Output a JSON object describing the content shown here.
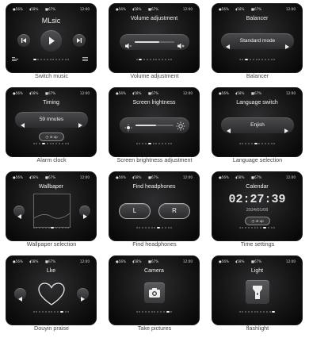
{
  "status": {
    "bt": "●56%",
    "signal": "◖58%",
    "headphones": "■67%",
    "time": "12:00"
  },
  "cells": [
    {
      "caption": "Switch music",
      "title": "MLsic"
    },
    {
      "caption": "Volume adjustment",
      "title": "Volume adjustment",
      "volume_level": 0.62
    },
    {
      "caption": "Balancer",
      "title": "Balancer",
      "value": "Standard mode"
    },
    {
      "caption": "Alarm clock",
      "title": "Timing",
      "value": "59 mnutes",
      "button": "ot up"
    },
    {
      "caption": "Screen brightness adjustment",
      "title": "Screen lrightness",
      "brightness_level": 0.55
    },
    {
      "caption": "Language selection",
      "title": "Language switch",
      "value": "Enjish"
    },
    {
      "caption": "Wallpaper selection",
      "title": "Wallbaper"
    },
    {
      "caption": "Find headphones",
      "title": "Find headphones",
      "left": "L",
      "right": "R"
    },
    {
      "caption": "Time settings",
      "title": "Calendar",
      "time": "02:27:39",
      "date": "2024/01/08",
      "button": "ot up"
    },
    {
      "caption": "Douyin praise",
      "title": "Lke"
    },
    {
      "caption": "Take pictures",
      "title": "Camera"
    },
    {
      "caption": "flashlight",
      "title": "Light"
    }
  ],
  "icons": [
    "bluetooth-icon",
    "signal-icon",
    "headphones-battery-icon",
    "battery-icon",
    "previous-track-icon",
    "play-icon",
    "next-track-icon",
    "equalizer-icon",
    "playlist-icon",
    "volume-down-icon",
    "volume-up-icon",
    "brightness-low-icon",
    "brightness-high-icon",
    "heart-icon",
    "camera-icon",
    "flashlight-icon",
    "left-arrow-icon",
    "right-arrow-icon"
  ],
  "colors": {
    "screen_bg": "#141415",
    "text": "#f0f0f0",
    "caption": "#444444"
  }
}
